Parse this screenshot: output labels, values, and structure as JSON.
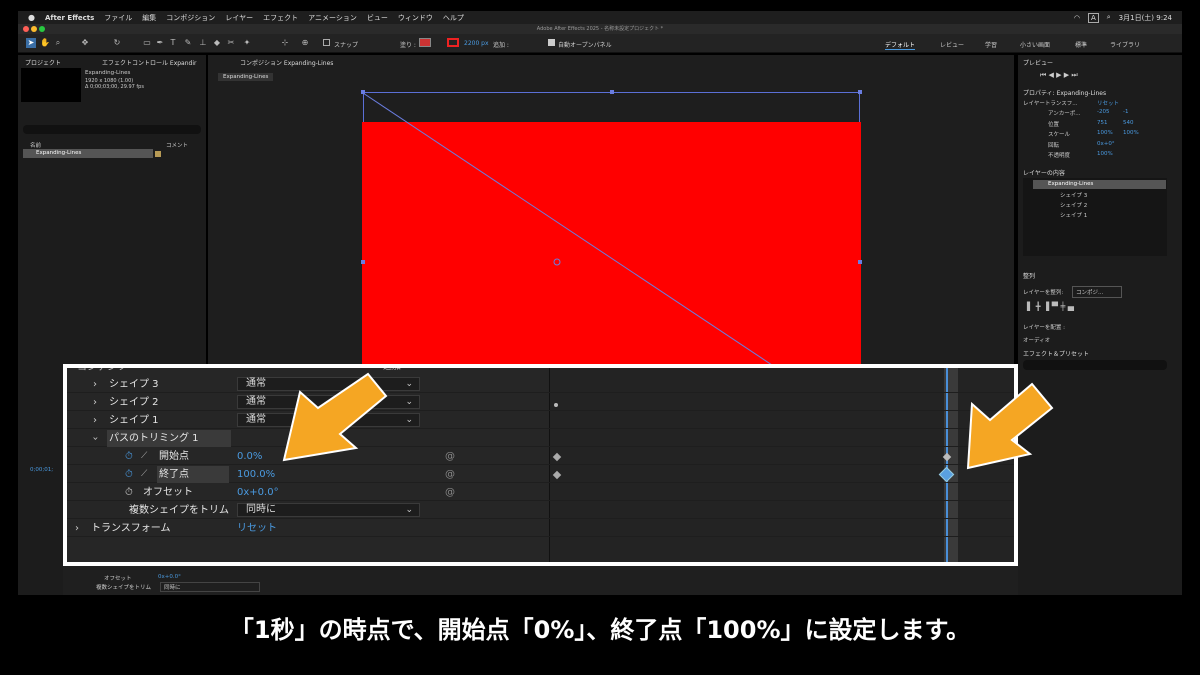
{
  "menubar": {
    "app_name": "After Effects",
    "items": [
      "ファイル",
      "編集",
      "コンポジション",
      "レイヤー",
      "エフェクト",
      "アニメーション",
      "ビュー",
      "ウィンドウ",
      "ヘルプ"
    ],
    "clock": "3月1日(土) 9:24",
    "input_badge": "A"
  },
  "window": {
    "title": "Adobe After Effects 2025 - 名称未設定プロジェクト *"
  },
  "toolbar": {
    "snap_label": "スナップ",
    "fill_label": "塗り :",
    "stroke_px": "2200 px",
    "add_label": "追加 :",
    "auto_open_label": "自動オープンパネル",
    "workspaces": [
      "デフォルト",
      "レビュー",
      "学習",
      "小さい画面",
      "標準",
      "ライブラリ"
    ]
  },
  "project_panel": {
    "tab_project": "プロジェクト",
    "tab_effects": "エフェクトコントロール Expandir",
    "item_name": "Expanding-Lines",
    "item_meta1": "1920 x 1080 (1.00)",
    "item_meta2": "Δ 0;00;03;00, 29.97 fps",
    "search_placeholder": "",
    "col_name": "名前",
    "col_comment": "コメント",
    "row_name": "Expanding-Lines"
  },
  "comp_panel": {
    "tab": "コンポジション Expanding-Lines",
    "flow_tab": "Expanding-Lines"
  },
  "right_panel": {
    "preview_title": "プレビュー",
    "properties_title": "プロパティ: Expanding-Lines",
    "layer_transform": "レイヤートランスフ...",
    "reset": "リセット",
    "props": [
      {
        "name": "アンカーポ...",
        "v1": "-205",
        "v2": "-1"
      },
      {
        "name": "位置",
        "v1": "751",
        "v2": "540"
      },
      {
        "name": "スケール",
        "v1": "100%",
        "v2": "100%"
      },
      {
        "name": "回転",
        "v1": "0x+0°",
        "v2": ""
      },
      {
        "name": "不透明度",
        "v1": "100%",
        "v2": ""
      }
    ],
    "layer_contents_title": "レイヤーの内容",
    "contents": [
      "Expanding-Lines",
      "シェイプ 3",
      "シェイプ 2",
      "シェイプ 1"
    ],
    "align_title": "整列",
    "align_to_label": "レイヤーを整列:",
    "align_to_value": "コンポジ...",
    "distribute_label": "レイヤーを配置 :",
    "audio_label": "オーディオ",
    "effects_title": "エフェクト＆プリセット"
  },
  "timeline": {
    "header_partial": "コンテンツ",
    "add_label": "追加",
    "rows": [
      {
        "label": "シェイプ 3",
        "mode": "通常"
      },
      {
        "label": "シェイプ 2",
        "mode": "通常"
      },
      {
        "label": "シェイプ 1",
        "mode": "通常"
      }
    ],
    "trim_group": "パスのトリミング 1",
    "start_label": "開始点",
    "start_value": "0.0%",
    "end_label": "終了点",
    "end_value": "100.0%",
    "offset_label": "オフセット",
    "offset_value": "0x+0.0°",
    "multi_label": "複数シェイプをトリム",
    "multi_value": "同時に",
    "transform_label": "トランスフォーム",
    "transform_reset": "リセット",
    "bg_timecode": "0;00;01;",
    "bg_offset_label": "オフセット",
    "bg_offset_value": "0x+0.0°",
    "bg_multi_label": "複数シェイプをトリム",
    "bg_multi_value": "同時に"
  },
  "caption": "「1秒」の時点で、開始点「0%」、終了点「100%」に設定します。",
  "colors": {
    "accent": "#4a9ae0",
    "comp_fill": "#ff0000",
    "arrow": "#f5a623"
  }
}
